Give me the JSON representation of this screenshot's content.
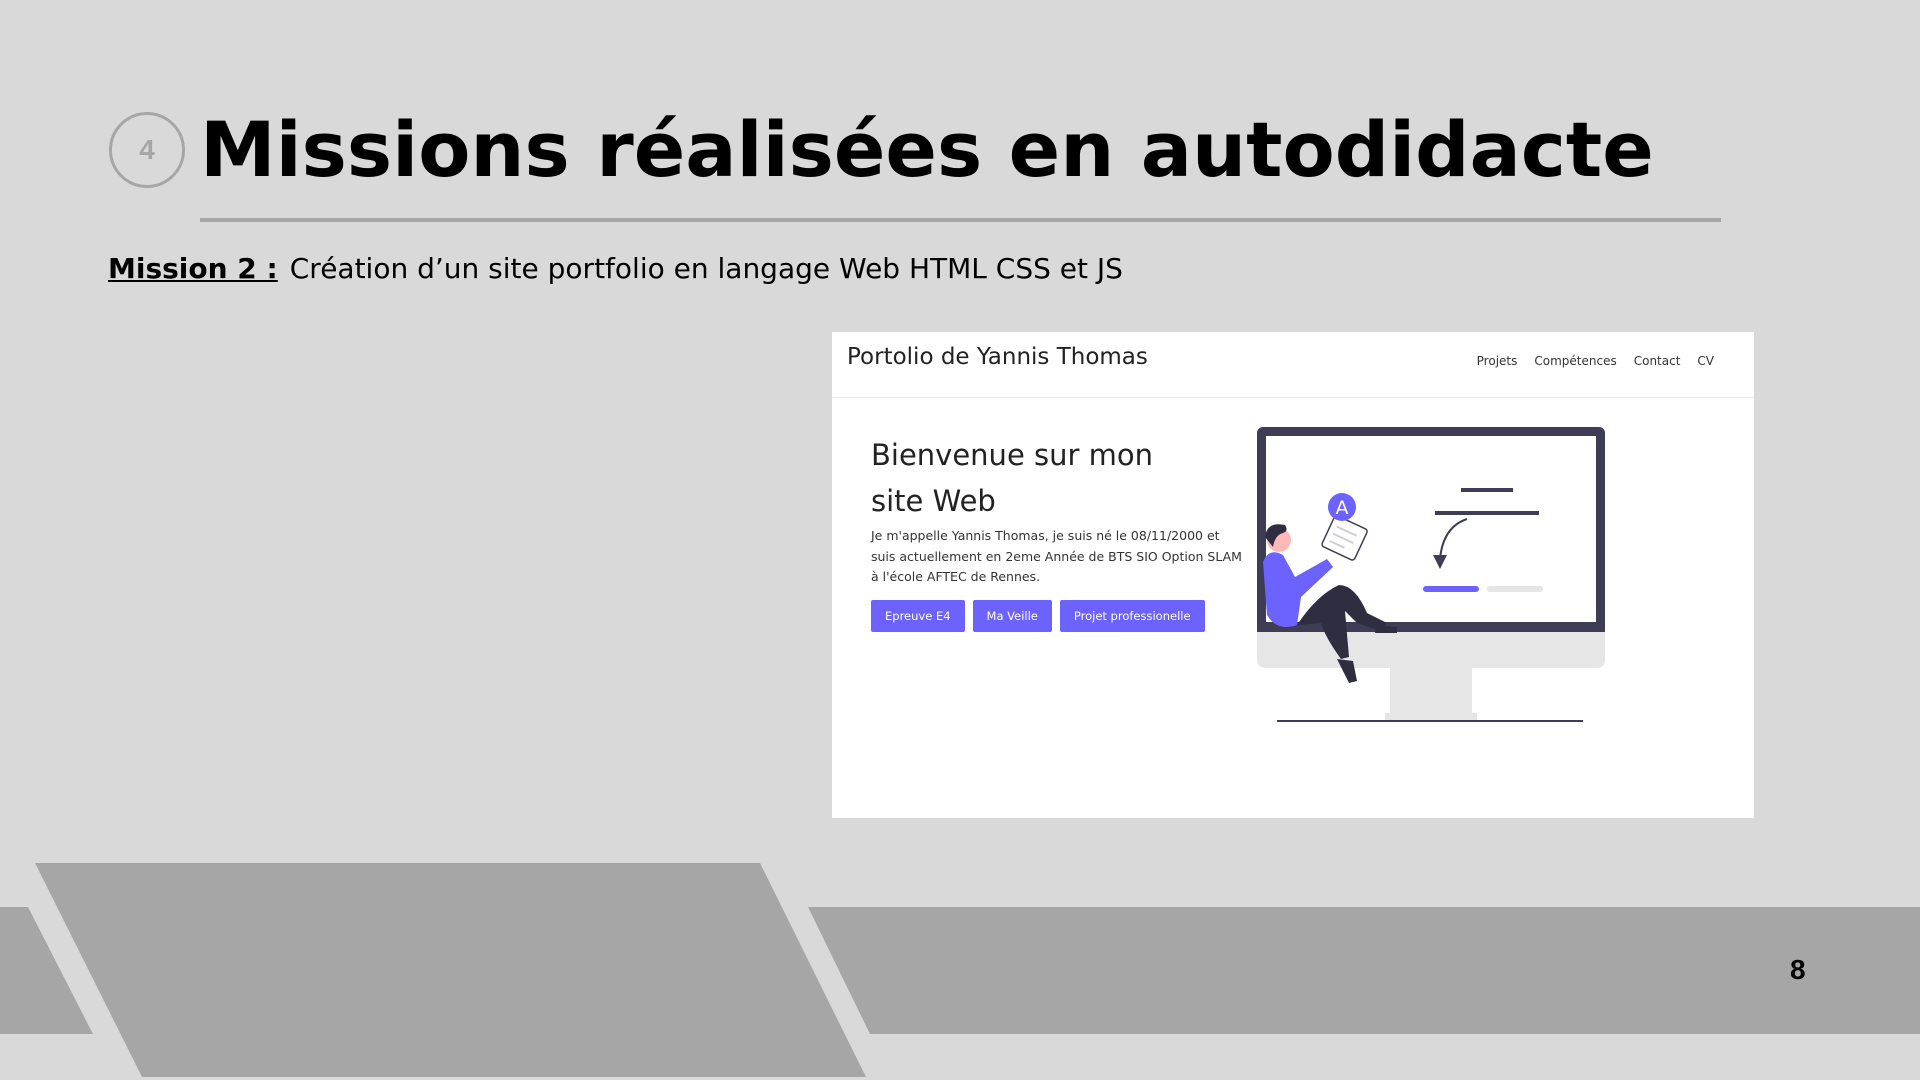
{
  "slide": {
    "section_number": "4",
    "title": "Missions réalisées en autodidacte",
    "mission_label": "Mission 2 :",
    "mission_text": "Création d’un site portfolio en langage Web HTML CSS et JS",
    "page_number": "8"
  },
  "website": {
    "brand": "Portolio de Yannis Thomas",
    "nav": [
      "Projets",
      "Compétences",
      "Contact",
      "CV"
    ],
    "hero_title": "Bienvenue sur mon site Web",
    "hero_text": "Je m'appelle Yannis Thomas, je suis né le 08/11/2000 et suis actuellement en 2eme Année de BTS SIO Option SLAM à l'école AFTEC de Rennes.",
    "buttons": [
      "Epreuve E4",
      "Ma Veille",
      "Projet professionelle"
    ],
    "illustration_letter": "A"
  },
  "colors": {
    "background": "#d9d9d9",
    "shape_gray": "#a6a6a6",
    "accent": "#6c63ff",
    "monitor_dark": "#3f3d56"
  }
}
